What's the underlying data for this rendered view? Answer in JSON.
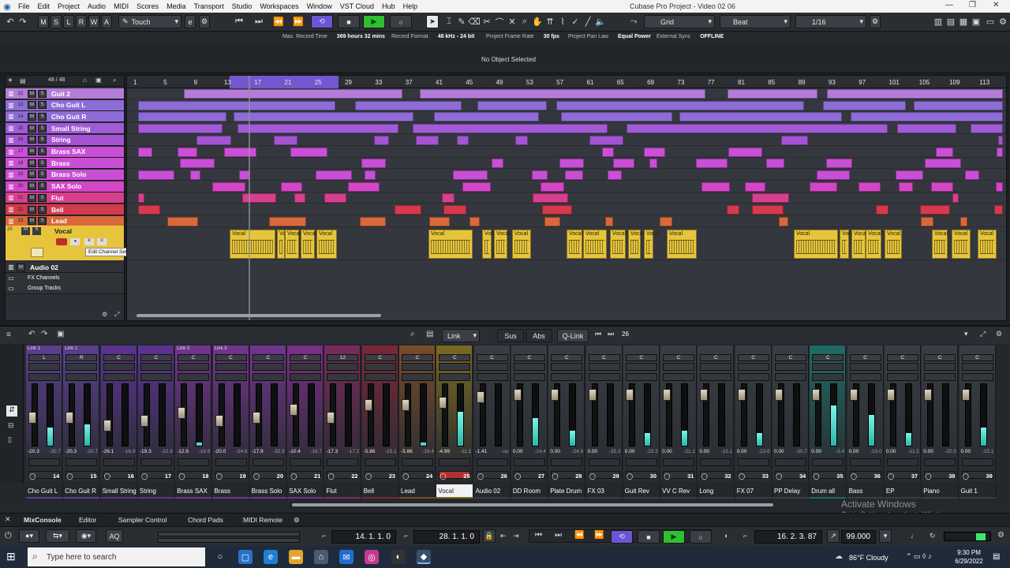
{
  "menubar": {
    "items": [
      "File",
      "Edit",
      "Project",
      "Audio",
      "MIDI",
      "Scores",
      "Media",
      "Transport",
      "Studio",
      "Workspaces",
      "Window",
      "VST Cloud",
      "Hub",
      "Help"
    ],
    "window_title": "Cubase Pro Project - Video 02 06"
  },
  "toolbar": {
    "modes": [
      "M",
      "S",
      "L",
      "R",
      "W",
      "A"
    ],
    "automation_mode": "Touch",
    "grid_type": "Grid",
    "grid_mode": "Beat",
    "quantize": "1/16"
  },
  "infobar": [
    {
      "label": "Max. Record Time",
      "value": "369 hours 32 mins"
    },
    {
      "label": "Record Format",
      "value": "48 kHz - 24 bit"
    },
    {
      "label": "Project Frame Rate",
      "value": "30 fps"
    },
    {
      "label": "Project Pan Law",
      "value": "Equal Power"
    },
    {
      "label": "External Sync",
      "value": "OFFLINE"
    }
  ],
  "selection_status": "No Object Selected",
  "track_count": "48 / 48",
  "tracks": [
    {
      "num": "22",
      "name": "Guit 2",
      "color": "#b57bd8"
    },
    {
      "num": "13",
      "name": "Cho Guit L",
      "color": "#8e6cd6"
    },
    {
      "num": "14",
      "name": "Cho Guit R",
      "color": "#8e6cd6"
    },
    {
      "num": "15",
      "name": "Small String",
      "color": "#a15bd6"
    },
    {
      "num": "16",
      "name": "String",
      "color": "#a453d3"
    },
    {
      "num": "17",
      "name": "Brass SAX",
      "color": "#c94fd6"
    },
    {
      "num": "18",
      "name": "Brass",
      "color": "#c94fd6"
    },
    {
      "num": "19",
      "name": "Brass Solo",
      "color": "#c94fd6"
    },
    {
      "num": "20",
      "name": "SAX Solo",
      "color": "#d346c6"
    },
    {
      "num": "21",
      "name": "Flut",
      "color": "#d73f8f"
    },
    {
      "num": "22",
      "name": "Bell",
      "color": "#d43a4c"
    },
    {
      "num": "23",
      "name": "Lead",
      "color": "#d9683a"
    }
  ],
  "vocal_track": {
    "num": "25",
    "name": "Vocal",
    "tooltip": "Edit Channel Settings",
    "clip_label": "Vocal"
  },
  "extra_tracks": [
    {
      "num": "26",
      "name": "Audio 02"
    },
    {
      "num": "",
      "name": "FX Channels"
    },
    {
      "num": "",
      "name": "Group Tracks"
    }
  ],
  "ruler_marks": [
    "1",
    "5",
    "9",
    "13",
    "17",
    "21",
    "25",
    "29",
    "33",
    "37",
    "41",
    "45",
    "49",
    "53",
    "57",
    "61",
    "65",
    "69",
    "73",
    "77",
    "81",
    "85",
    "89",
    "93",
    "97",
    "101",
    "105",
    "109",
    "113"
  ],
  "mixer": {
    "link_label": "Link",
    "sus": "Sus",
    "abs": "Abs",
    "qlink": "Q-Link",
    "channel_count": "26",
    "channels": [
      {
        "num": "14",
        "name": "Cho Guit L",
        "pan": "L",
        "link": "Link 1",
        "val1": "-20.3",
        "val2": "-30.7",
        "color": "#5b3f8f",
        "fader": 0.45,
        "meter": 0.3
      },
      {
        "num": "15",
        "name": "Cho Guit R",
        "pan": "R",
        "link": "Link 1",
        "val1": "-20.3",
        "val2": "-20.7",
        "color": "#5b3f8f",
        "fader": 0.45,
        "meter": 0.35
      },
      {
        "num": "16",
        "name": "Small String",
        "pan": "C",
        "link": "",
        "val1": "-26.1",
        "val2": "-16.8",
        "color": "#5b3392",
        "fader": 0.3,
        "meter": 0.0
      },
      {
        "num": "17",
        "name": "String",
        "pan": "C",
        "link": "",
        "val1": "-19.3",
        "val2": "-22.8",
        "color": "#5b3392",
        "fader": 0.4,
        "meter": 0.0
      },
      {
        "num": "18",
        "name": "Brass SAX",
        "pan": "C",
        "link": "Link 3",
        "val1": "-12.9",
        "val2": "-19.9",
        "color": "#73348f",
        "fader": 0.55,
        "meter": 0.05
      },
      {
        "num": "19",
        "name": "Brass",
        "pan": "C",
        "link": "Link 3",
        "val1": "-20.0",
        "val2": "-24.8",
        "color": "#73348f",
        "fader": 0.4,
        "meter": 0.0
      },
      {
        "num": "20",
        "name": "Brass Solo",
        "pan": "C",
        "link": "",
        "val1": "-17.9",
        "val2": "-32.5",
        "color": "#73348f",
        "fader": 0.45,
        "meter": 0.0
      },
      {
        "num": "21",
        "name": "SAX Solo",
        "pan": "C",
        "link": "",
        "val1": "-10.4",
        "val2": "-19.7",
        "color": "#7a2f86",
        "fader": 0.6,
        "meter": 0.0
      },
      {
        "num": "22",
        "name": "Flut",
        "pan": "12",
        "link": "",
        "val1": "-17.3",
        "val2": "-17.2",
        "color": "#7a2a5e",
        "fader": 0.45,
        "meter": 0.0
      },
      {
        "num": "23",
        "name": "Bell",
        "pan": "C",
        "link": "",
        "val1": "-5.86",
        "val2": "-15.1",
        "color": "#7a2838",
        "fader": 0.7,
        "meter": 0.0
      },
      {
        "num": "24",
        "name": "Lead",
        "pan": "C",
        "link": "",
        "val1": "-5.86",
        "val2": "-18.4",
        "color": "#7a4a2a",
        "fader": 0.7,
        "meter": 0.05
      },
      {
        "num": "25",
        "name": "Vocal",
        "pan": "C",
        "link": "",
        "val1": "-4.99",
        "val2": "-11.1",
        "color": "#7a6a22",
        "fader": 0.75,
        "meter": 0.55
      },
      {
        "num": "26",
        "name": "Audio 02",
        "pan": "C",
        "link": "",
        "val1": "-1.41",
        "val2": "-oo",
        "color": "#3a3d43",
        "fader": 0.85,
        "meter": 0.0
      },
      {
        "num": "27",
        "name": "DD Room",
        "pan": "C",
        "link": "",
        "val1": "0.00",
        "val2": "-14.4",
        "color": "#3a3d43",
        "fader": 0.9,
        "meter": 0.45
      },
      {
        "num": "28",
        "name": "Plate Drum",
        "pan": "C",
        "link": "",
        "val1": "0.00",
        "val2": "-24.9",
        "color": "#3a3d43",
        "fader": 0.9,
        "meter": 0.25
      },
      {
        "num": "29",
        "name": "FX 03",
        "pan": "C",
        "link": "",
        "val1": "0.00",
        "val2": "-35.3",
        "color": "#3a3d43",
        "fader": 0.9,
        "meter": 0.0
      },
      {
        "num": "30",
        "name": "Guit Rev",
        "pan": "C",
        "link": "",
        "val1": "0.00",
        "val2": "-23.3",
        "color": "#3a3d43",
        "fader": 0.9,
        "meter": 0.2
      },
      {
        "num": "31",
        "name": "VV C Rev",
        "pan": "C",
        "link": "",
        "val1": "0.00",
        "val2": "-21.1",
        "color": "#3a3d43",
        "fader": 0.9,
        "meter": 0.25
      },
      {
        "num": "32",
        "name": "Long",
        "pan": "C",
        "link": "",
        "val1": "0.00",
        "val2": "-15.1",
        "color": "#3a3d43",
        "fader": 0.9,
        "meter": 0.0
      },
      {
        "num": "33",
        "name": "FX 07",
        "pan": "C",
        "link": "",
        "val1": "0.00",
        "val2": "-23.6",
        "color": "#3a3d43",
        "fader": 0.9,
        "meter": 0.2
      },
      {
        "num": "34",
        "name": "PP Delay",
        "pan": "C",
        "link": "",
        "val1": "0.00",
        "val2": "-30.7",
        "color": "#3a3d43",
        "fader": 0.9,
        "meter": 0.0
      },
      {
        "num": "35",
        "name": "Drum all",
        "pan": "C",
        "link": "",
        "val1": "0.00",
        "val2": "-5.4",
        "color": "#1f6b66",
        "fader": 0.9,
        "meter": 0.65
      },
      {
        "num": "36",
        "name": "Bass",
        "pan": "C",
        "link": "",
        "val1": "0.00",
        "val2": "-19.0",
        "color": "#3a3d43",
        "fader": 0.9,
        "meter": 0.5
      },
      {
        "num": "37",
        "name": "EP",
        "pan": "C",
        "link": "",
        "val1": "0.00",
        "val2": "-11.5",
        "color": "#3a3d43",
        "fader": 0.9,
        "meter": 0.2
      },
      {
        "num": "38",
        "name": "Piano",
        "pan": "C",
        "link": "",
        "val1": "0.00",
        "val2": "-20.5",
        "color": "#3a3d43",
        "fader": 0.9,
        "meter": 0.0
      },
      {
        "num": "39",
        "name": "Guit 1",
        "pan": "C",
        "link": "",
        "val1": "0.00",
        "val2": "-15.1",
        "color": "#3a3d43",
        "fader": 0.9,
        "meter": 0.3
      }
    ]
  },
  "bottom_tabs": [
    "MixConsole",
    "Editor",
    "Sampler Control",
    "Chord Pads",
    "MIDI Remote"
  ],
  "transport": {
    "left_locator": "14. 1. 1. 0",
    "right_locator": "28. 1. 1. 0",
    "position": "16. 2. 3. 87",
    "tempo": "99.000"
  },
  "watermark": {
    "title": "Activate Windows",
    "subtitle": "Go to Settings to activate Windows."
  },
  "taskbar": {
    "search_placeholder": "Type here to search",
    "weather": "86°F  Cloudy",
    "time": "9:30 PM",
    "date": "6/29/2022"
  },
  "colors": {
    "vocal": "#e6c53d",
    "lead": "#d9683a",
    "bell": "#d43a4c",
    "cycle": "#7b5ce0",
    "meter": "#5ee0d4"
  }
}
